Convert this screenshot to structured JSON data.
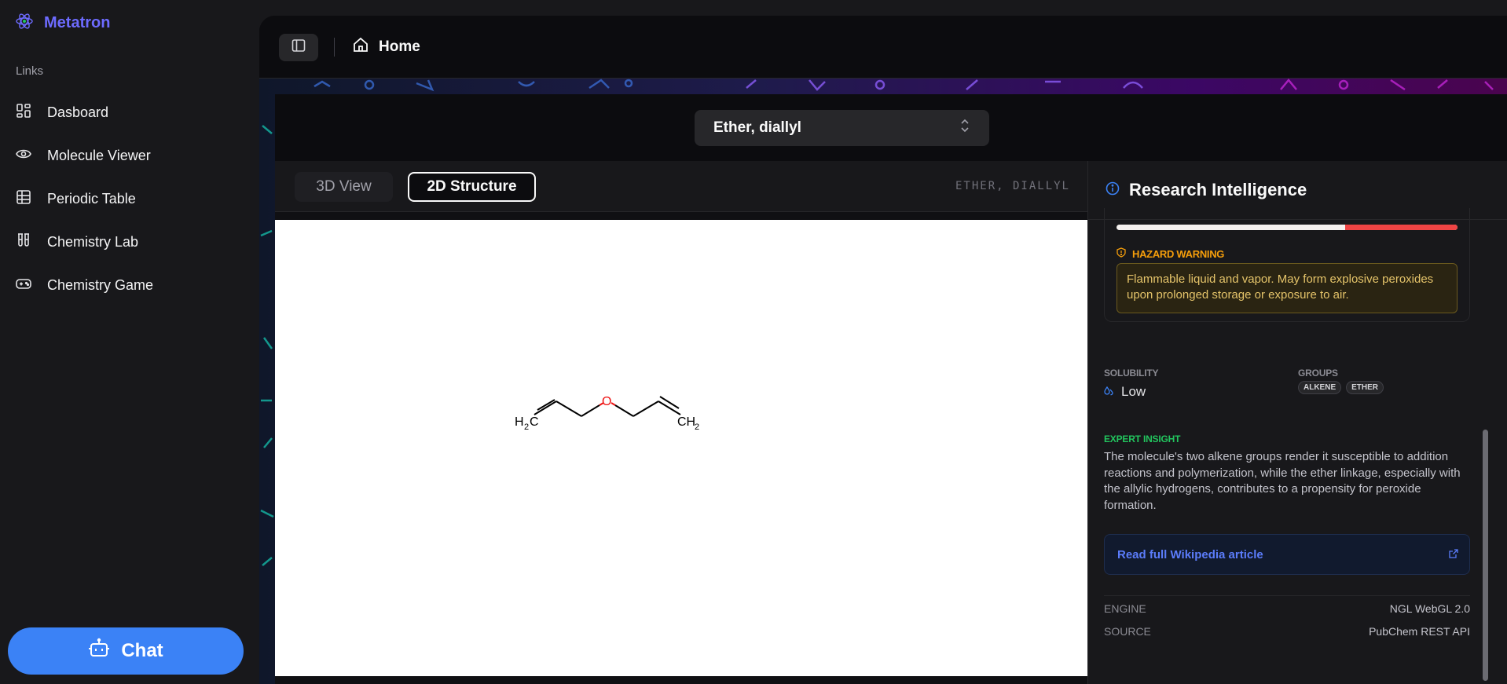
{
  "app": {
    "name": "Metatron",
    "brand_color": "#6d6bff"
  },
  "sidebar": {
    "section_label": "Links",
    "items": [
      {
        "label": "Dasboard",
        "icon": "dashboard-icon"
      },
      {
        "label": "Molecule Viewer",
        "icon": "eye-icon"
      },
      {
        "label": "Periodic Table",
        "icon": "table-icon"
      },
      {
        "label": "Chemistry Lab",
        "icon": "test-tubes-icon"
      },
      {
        "label": "Chemistry Game",
        "icon": "gamepad-icon"
      }
    ],
    "chat_label": "Chat"
  },
  "topbar": {
    "breadcrumb": "Home"
  },
  "selector": {
    "value": "Ether, diallyl"
  },
  "viewer": {
    "tabs": [
      "3D View",
      "2D Structure"
    ],
    "active_tab": "2D Structure",
    "caption": "ETHER, DIALLYL",
    "structure_atoms": {
      "left_terminal": "H",
      "left_terminal_sub": "2",
      "left_terminal_c": "C",
      "oxygen": "O",
      "right_terminal": "CH",
      "right_terminal_sub": "2"
    }
  },
  "research": {
    "title": "Research Intelligence",
    "hazard_level_fraction": 0.33,
    "hazard_label": "HAZARD WARNING",
    "hazard_text": "Flammable liquid and vapor. May form explosive peroxides upon prolonged storage or exposure to air.",
    "solubility_label": "SOLUBILITY",
    "solubility_value": "Low",
    "groups_label": "GROUPS",
    "groups": [
      "ALKENE",
      "ETHER"
    ],
    "insight_label": "EXPERT INSIGHT",
    "insight_text": "The molecule's two alkene groups render it susceptible to addition reactions and polymerization, while the ether linkage, especially with the allylic hydrogens, contributes to a propensity for peroxide formation.",
    "wiki_label": "Read full Wikipedia article",
    "meta": [
      {
        "key": "ENGINE",
        "value": "NGL WebGL 2.0"
      },
      {
        "key": "SOURCE",
        "value": "PubChem REST API"
      }
    ]
  }
}
